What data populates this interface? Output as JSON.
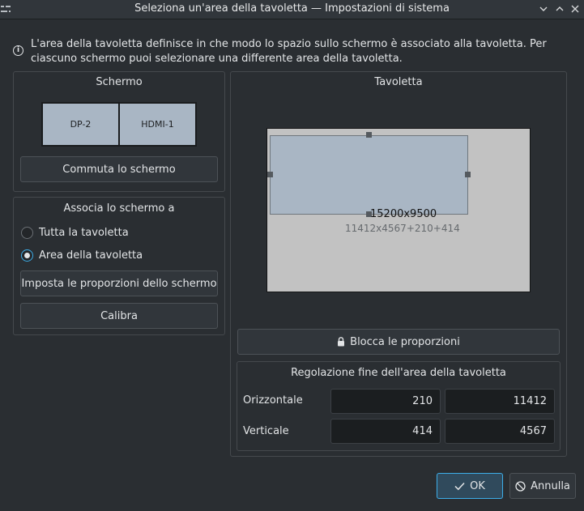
{
  "window": {
    "title": "Seleziona un'area della tavoletta — Impostazioni di sistema"
  },
  "info": {
    "text": "L'area della tavoletta definisce in che modo lo spazio sullo schermo è associato alla tavoletta. Per ciascuno schermo puoi selezionare una differente area della tavoletta."
  },
  "screen_panel": {
    "title": "Schermo",
    "monitors": [
      "DP-2",
      "HDMI-1"
    ],
    "toggle_button": "Commuta lo schermo"
  },
  "map_panel": {
    "title": "Associa lo schermo a",
    "options": [
      {
        "label": "Tutta la tavoletta",
        "checked": false
      },
      {
        "label": "Area della tavoletta",
        "checked": true
      }
    ],
    "proportions_button": "Imposta le proporzioni dello schermo",
    "calibrate_button": "Calibra"
  },
  "tablet_panel": {
    "title": "Tavoletta",
    "full_size": "15200x9500",
    "area_geometry": "11412x4567+210+414",
    "lock_button": "Blocca le proporzioni"
  },
  "fine_tune": {
    "title": "Regolazione fine dell'area della tavoletta",
    "horizontal_label": "Orizzontale",
    "vertical_label": "Verticale",
    "horizontal_offset": "210",
    "horizontal_size": "11412",
    "vertical_offset": "414",
    "vertical_size": "4567"
  },
  "dialog_buttons": {
    "ok": "OK",
    "cancel": "Annulla"
  },
  "colors": {
    "background": "#2a2e32",
    "accent": "#3daee9",
    "ok_button": "#304a5c",
    "area_fill": "#a9b6c4",
    "tablet_bg": "#c2c2c2"
  }
}
